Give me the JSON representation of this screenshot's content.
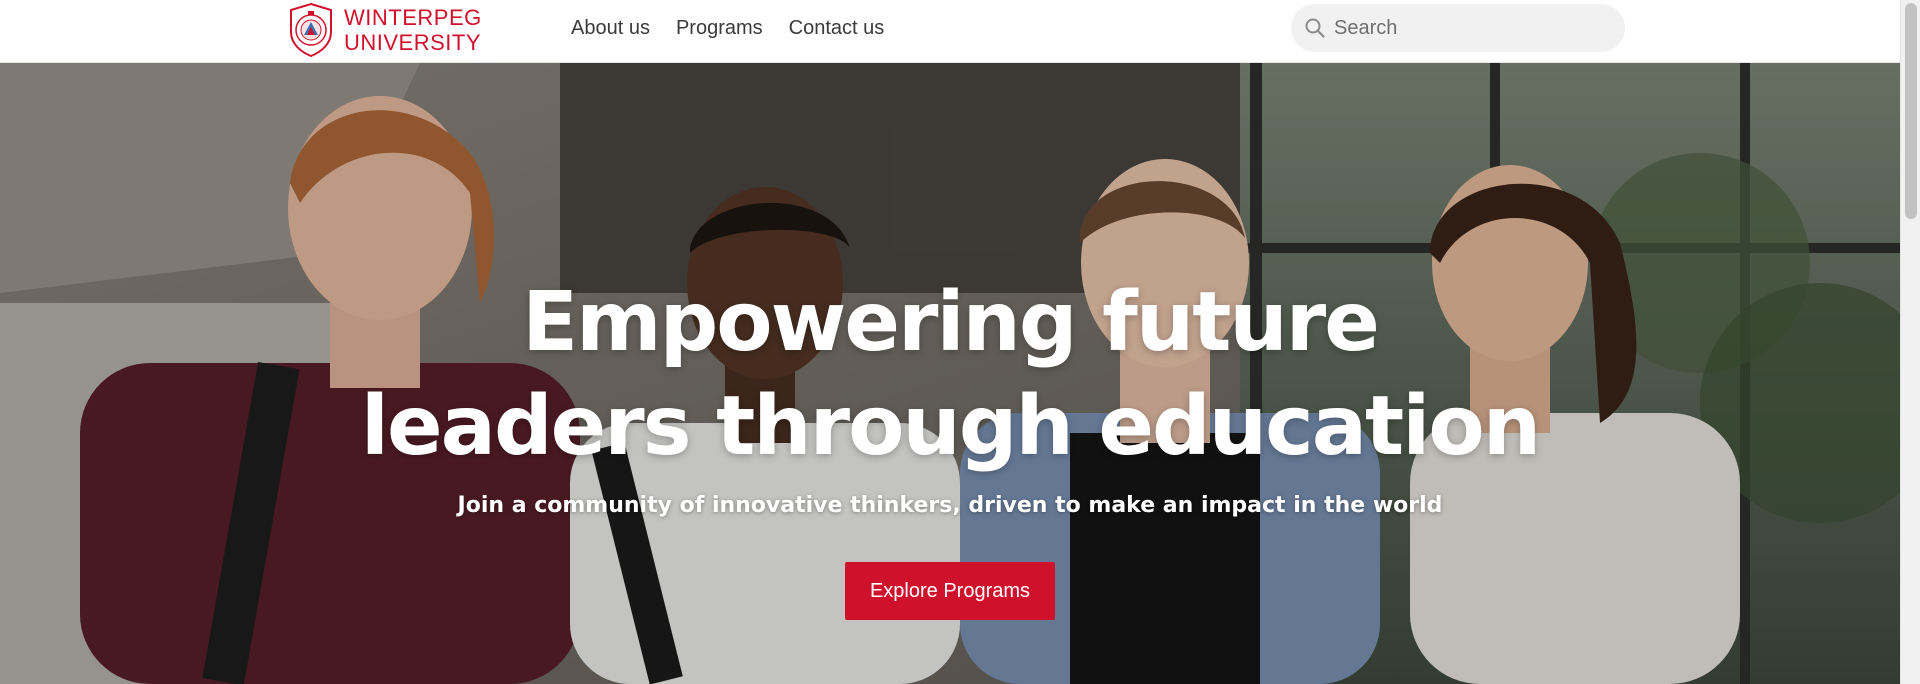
{
  "header": {
    "logo": {
      "line1": "WINTERPEG",
      "line2": "UNIVERSITY",
      "seal_text_top": "WINTERPEG",
      "seal_text_bottom": "UNIVERSITY",
      "icon": "university-seal-icon"
    },
    "nav": [
      {
        "label": "About us"
      },
      {
        "label": "Programs"
      },
      {
        "label": "Contact us"
      }
    ],
    "search": {
      "placeholder": "Search",
      "value": "",
      "icon": "search-icon"
    }
  },
  "hero": {
    "title_line1": "Empowering future",
    "title_line2": "leaders through education",
    "subtitle": "Join a community of innovative thinkers, driven to make an impact in the world",
    "cta_label": "Explore Programs",
    "image": "students-photo"
  },
  "colors": {
    "brand_red": "#d0112b",
    "nav_text": "#3a3a3a",
    "search_bg": "#f1f1f1"
  }
}
